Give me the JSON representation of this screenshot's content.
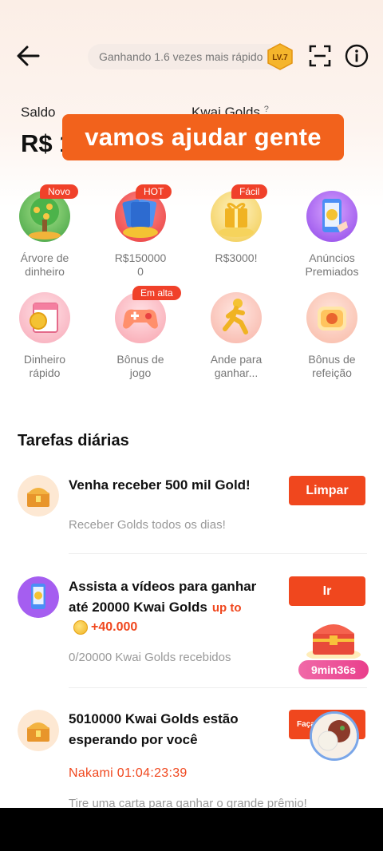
{
  "header": {
    "speed_text": "Ganhando 1.6 vezes mais rápido",
    "level_badge": "LV.7"
  },
  "balance": {
    "saldo_label": "Saldo",
    "saldo_value": "R$ 1",
    "gold_label": "Kwai Golds",
    "gold_help": "?"
  },
  "overlay_caption": "vamos ajudar gente",
  "features": [
    {
      "label": "Árvore de dinheiro",
      "badge": "Novo",
      "icon": "money-tree-icon"
    },
    {
      "label": "R$1500000",
      "badge": "HOT",
      "icon": "cards-coins-icon"
    },
    {
      "label": "R$3000!",
      "badge": "Fácil",
      "icon": "gold-gift-icon"
    },
    {
      "label": "Anúncios Premiados",
      "badge": "",
      "icon": "phone-ad-icon"
    },
    {
      "label": "Dinheiro rápido",
      "badge": "",
      "icon": "coin-calendar-icon"
    },
    {
      "label": "Bônus de jogo",
      "badge": "Em alta",
      "icon": "gamepad-icon"
    },
    {
      "label": "Ande para ganhar...",
      "badge": "",
      "icon": "walking-man-icon"
    },
    {
      "label": "Bônus de refeição",
      "badge": "",
      "icon": "meal-icon"
    }
  ],
  "tasks_title": "Tarefas diárias",
  "tasks": [
    {
      "title": "Venha receber 500 mil Gold!",
      "subtitle": "Receber Golds todos os dias!",
      "button": "Limpar"
    },
    {
      "title_line1": "Assista a vídeos para ganhar",
      "title_line2": "até 20000 Kwai Golds",
      "upto": "up to",
      "bonus": "+40.000",
      "subtitle": "0/20000 Kwai Golds recebidos",
      "button": "Ir"
    },
    {
      "title_line1": "5010000 Kwai Golds estão",
      "title_line2": "esperando por você",
      "countdown": "Nakami  01:04:23:39",
      "subtitle": "Tire uma carta para ganhar o grande prêmio!",
      "button": "Faça"
    }
  ],
  "floating_timer": "9min36s",
  "colors": {
    "accent": "#f0471e",
    "overlay": "#f2621c",
    "badge": "#f0412a",
    "timer": "#e93f8c"
  }
}
